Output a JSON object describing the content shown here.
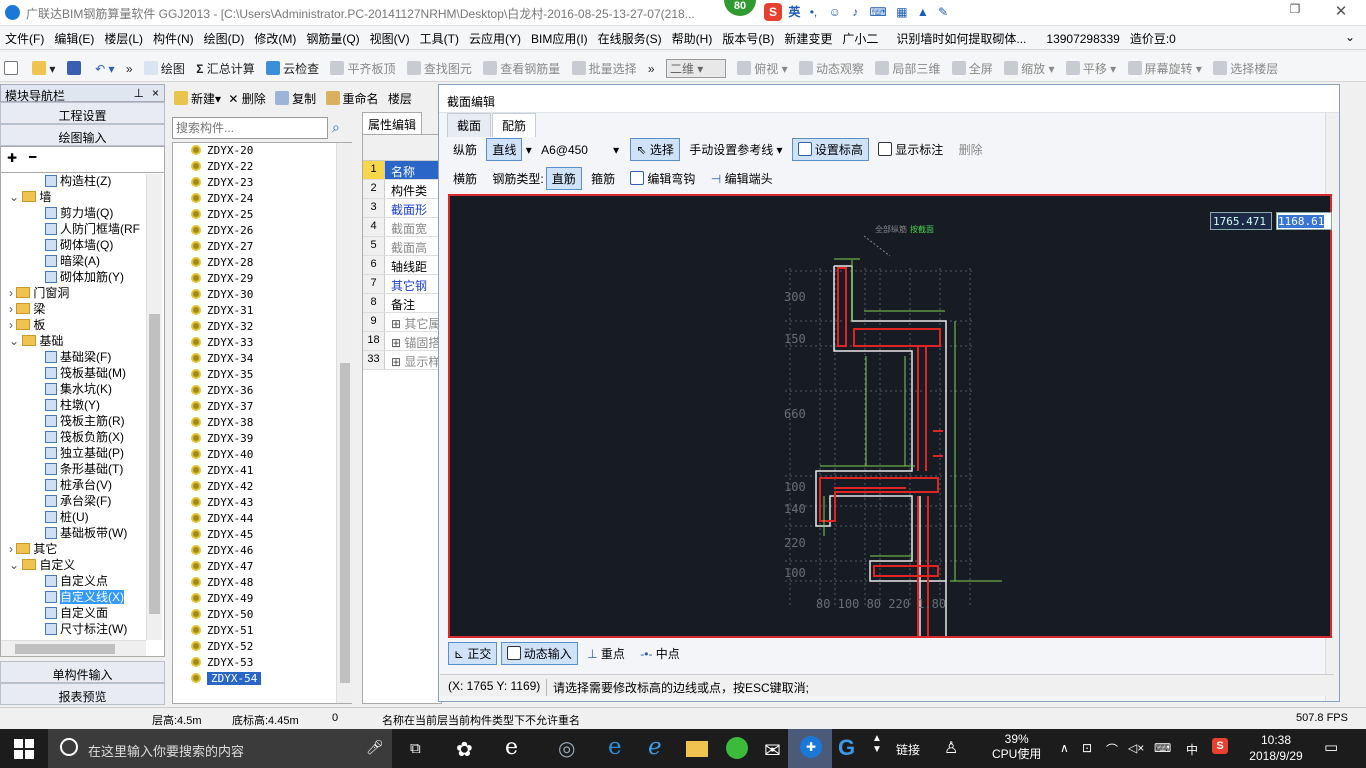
{
  "window": {
    "title": "广联达BIM钢筋算量软件 GGJ2013 - [C:\\Users\\Administrator.PC-20141127NRHM\\Desktop\\白龙村-2016-08-25-13-27-07(218...",
    "badge": "80",
    "ime_label": "英"
  },
  "menu": [
    "文件(F)",
    "编辑(E)",
    "楼层(L)",
    "构件(N)",
    "绘图(D)",
    "修改(M)",
    "钢筋量(Q)",
    "视图(V)",
    "工具(T)",
    "云应用(Y)",
    "BIM应用(I)",
    "在线服务(S)",
    "帮助(H)",
    "版本号(B)",
    "新建变更",
    "广小二",
    "识别墙时如何提取砌体...",
    "13907298339",
    "造价豆:0"
  ],
  "toolbar": {
    "items": [
      "绘图",
      "汇总计算",
      "云检查",
      "平齐板顶",
      "查找图元",
      "查看钢筋量",
      "批量选择"
    ],
    "view_select": "二维",
    "items2": [
      "俯视",
      "动态观察",
      "局部三维",
      "全屏",
      "缩放",
      "平移",
      "屏幕旋转",
      "选择楼层"
    ]
  },
  "nav": {
    "title": "模块导航栏",
    "pin": "⊥",
    "close": "×",
    "btn_project": "工程设置",
    "btn_draw": "绘图输入",
    "btn_single": "单构件输入",
    "btn_report": "报表预览",
    "tree": [
      {
        "label": "构造柱(Z)",
        "level": 2,
        "type": "item"
      },
      {
        "label": "墙",
        "level": 1,
        "type": "folder",
        "state": "−"
      },
      {
        "label": "剪力墙(Q)",
        "level": 2,
        "type": "item"
      },
      {
        "label": "人防门框墙(RF",
        "level": 2,
        "type": "item"
      },
      {
        "label": "砌体墙(Q)",
        "level": 2,
        "type": "item"
      },
      {
        "label": "暗梁(A)",
        "level": 2,
        "type": "item"
      },
      {
        "label": "砌体加筋(Y)",
        "level": 2,
        "type": "item"
      },
      {
        "label": "门窗洞",
        "level": 1,
        "type": "folder",
        "state": "+"
      },
      {
        "label": "梁",
        "level": 1,
        "type": "folder",
        "state": "+"
      },
      {
        "label": "板",
        "level": 1,
        "type": "folder",
        "state": "+"
      },
      {
        "label": "基础",
        "level": 1,
        "type": "folder",
        "state": "−"
      },
      {
        "label": "基础梁(F)",
        "level": 2,
        "type": "item"
      },
      {
        "label": "筏板基础(M)",
        "level": 2,
        "type": "item"
      },
      {
        "label": "集水坑(K)",
        "level": 2,
        "type": "item"
      },
      {
        "label": "柱墩(Y)",
        "level": 2,
        "type": "item"
      },
      {
        "label": "筏板主筋(R)",
        "level": 2,
        "type": "item"
      },
      {
        "label": "筏板负筋(X)",
        "level": 2,
        "type": "item"
      },
      {
        "label": "独立基础(P)",
        "level": 2,
        "type": "item"
      },
      {
        "label": "条形基础(T)",
        "level": 2,
        "type": "item"
      },
      {
        "label": "桩承台(V)",
        "level": 2,
        "type": "item"
      },
      {
        "label": "承台梁(F)",
        "level": 2,
        "type": "item"
      },
      {
        "label": "桩(U)",
        "level": 2,
        "type": "item"
      },
      {
        "label": "基础板带(W)",
        "level": 2,
        "type": "item"
      },
      {
        "label": "其它",
        "level": 1,
        "type": "folder",
        "state": "+"
      },
      {
        "label": "自定义",
        "level": 1,
        "type": "folder",
        "state": "−"
      },
      {
        "label": "自定义点",
        "level": 2,
        "type": "item"
      },
      {
        "label": "自定义线(X)",
        "level": 2,
        "type": "item",
        "selected": true
      },
      {
        "label": "自定义面",
        "level": 2,
        "type": "item"
      },
      {
        "label": "尺寸标注(W)",
        "level": 2,
        "type": "item"
      }
    ]
  },
  "comp": {
    "new": "新建",
    "delete": "删除",
    "copy": "复制",
    "rename": "重命名",
    "floor": "楼层",
    "search_placeholder": "搜索构件...",
    "items": [
      "ZDYX-20",
      "ZDYX-22",
      "ZDYX-23",
      "ZDYX-24",
      "ZDYX-25",
      "ZDYX-26",
      "ZDYX-27",
      "ZDYX-28",
      "ZDYX-29",
      "ZDYX-30",
      "ZDYX-31",
      "ZDYX-32",
      "ZDYX-33",
      "ZDYX-34",
      "ZDYX-35",
      "ZDYX-36",
      "ZDYX-37",
      "ZDYX-38",
      "ZDYX-39",
      "ZDYX-40",
      "ZDYX-41",
      "ZDYX-42",
      "ZDYX-43",
      "ZDYX-44",
      "ZDYX-45",
      "ZDYX-46",
      "ZDYX-47",
      "ZDYX-48",
      "ZDYX-49",
      "ZDYX-50",
      "ZDYX-51",
      "ZDYX-52",
      "ZDYX-53",
      "ZDYX-54"
    ],
    "selected": "ZDYX-54"
  },
  "props": {
    "tab": "属性编辑",
    "rows": [
      {
        "n": "1",
        "k": "名称",
        "sel": true
      },
      {
        "n": "2",
        "k": "构件类"
      },
      {
        "n": "3",
        "k": "截面形",
        "blue": true
      },
      {
        "n": "4",
        "k": "截面宽",
        "gray": true
      },
      {
        "n": "5",
        "k": "截面高",
        "gray": true
      },
      {
        "n": "6",
        "k": "轴线距"
      },
      {
        "n": "7",
        "k": "其它钢",
        "blue": true
      },
      {
        "n": "8",
        "k": "备注"
      },
      {
        "n": "9",
        "k": "其它属",
        "gray": true,
        "plus": true
      },
      {
        "n": "18",
        "k": "锚固搭",
        "gray": true,
        "plus": true
      },
      {
        "n": "33",
        "k": "显示样",
        "gray": true,
        "plus": true
      }
    ]
  },
  "dialog": {
    "title": "截面编辑",
    "tab1": "截面",
    "tab2": "配筋",
    "row1": {
      "label": "纵筋",
      "mode": "直线",
      "spec": "A6@450",
      "select": "选择",
      "manual": "手动设置参考线",
      "set_elev": "设置标高",
      "show_mark": "显示标注",
      "delete": "删除"
    },
    "row2": {
      "label": "横筋",
      "type_label": "钢筋类型:",
      "straight": "直筋",
      "stirrup": "箍筋",
      "edit_hook": "编辑弯钩",
      "edit_end": "编辑端头"
    },
    "coord_x": "1765.471",
    "coord_y": "1168.61",
    "bottom": {
      "ortho": "正交",
      "dyn": "动态输入",
      "endpoint": "重点",
      "midpoint": "中点"
    },
    "status_xy": "(X: 1765 Y: 1169)",
    "status_msg": "请选择需要修改标高的边线或点，按ESC键取消;",
    "dims": [
      "300",
      "150",
      "660",
      "100",
      "140",
      "220",
      "100"
    ],
    "bottom_dims": "80 100 80   220   1.80",
    "label_all": "全部纵筋",
    "label_green": "按截面"
  },
  "status": {
    "floor_h": "层高:4.5m",
    "base_h": "底标高:4.45m",
    "zero": "0",
    "msg": "名称在当前层当前构件类型下不允许重名",
    "fps": "507.8 FPS"
  },
  "taskbar": {
    "search": "在这里输入你要搜索的内容",
    "link": "链接",
    "cpu_pct": "39%",
    "cpu_label": "CPU使用",
    "lang": "中",
    "time": "10:38",
    "date": "2018/9/29"
  }
}
